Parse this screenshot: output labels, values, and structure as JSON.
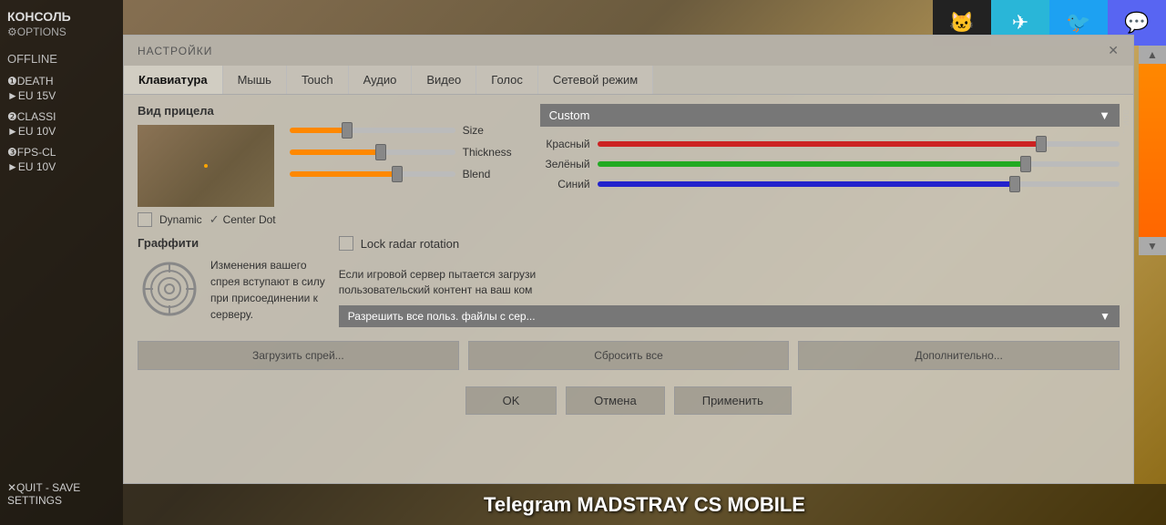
{
  "background": {
    "color": "#5a4a3a"
  },
  "sidebar": {
    "title": "КОНСОЛЬ",
    "options": "⚙OPTIONS",
    "offline": "OFFLINE",
    "items": [
      {
        "number": "❶",
        "name": "DEATH",
        "server": "►EU 15V"
      },
      {
        "number": "❷",
        "name": "CLASSI",
        "server": "►EU 10V"
      },
      {
        "number": "❸",
        "name": "FPS-CL",
        "server": "►EU 10V"
      }
    ],
    "quit_label": "✕QUIT - SAVE SETTINGS"
  },
  "top_icons": [
    {
      "name": "github",
      "symbol": "🐱",
      "bg": "#222"
    },
    {
      "name": "telegram",
      "symbol": "✈",
      "bg": "#29b6d8"
    },
    {
      "name": "twitter",
      "symbol": "🐦",
      "bg": "#1da1f2"
    },
    {
      "name": "discord",
      "symbol": "💬",
      "bg": "#5865f2"
    }
  ],
  "bottom_text": "Telegram MADSTRAY CS MOBILE",
  "modal": {
    "title": "НАСТРОЙКИ",
    "close": "✕",
    "tabs": [
      {
        "id": "keyboard",
        "label": "Клавиатура",
        "active": false
      },
      {
        "id": "mouse",
        "label": "Мышь",
        "active": false
      },
      {
        "id": "touch",
        "label": "Touch",
        "active": true
      },
      {
        "id": "audio",
        "label": "Аудио",
        "active": false
      },
      {
        "id": "video",
        "label": "Видео",
        "active": false
      },
      {
        "id": "voice",
        "label": "Голос",
        "active": false
      },
      {
        "id": "network",
        "label": "Сетевой режим",
        "active": false
      }
    ],
    "crosshair": {
      "section_label": "Вид прицела",
      "dynamic_label": "Dynamic",
      "center_dot_label": "Center Dot",
      "dynamic_checked": false,
      "center_dot_checked": true
    },
    "sliders": [
      {
        "id": "size",
        "label": "Size",
        "value": 35
      },
      {
        "id": "thickness",
        "label": "Thickness",
        "value": 55
      },
      {
        "id": "blend",
        "label": "Blend",
        "value": 65
      }
    ],
    "color": {
      "dropdown_label": "Custom",
      "dropdown_arrow": "▼",
      "sliders": [
        {
          "id": "red",
          "label": "Красный",
          "value": 85,
          "class": "red"
        },
        {
          "id": "green",
          "label": "Зелёный",
          "value": 82,
          "class": "green"
        },
        {
          "id": "blue",
          "label": "Синий",
          "value": 80,
          "class": "blue"
        }
      ]
    },
    "graffiti": {
      "section_label": "Граффити",
      "info_text": "Изменения вашего\nспрея вступают в силу\nпри присоединении к\nсерверу."
    },
    "lock_radar": {
      "label": "Lock radar rotation",
      "checked": false
    },
    "server": {
      "text": "Если игровой сервер пытается загрузи\nпользовательский контент на ваш ком",
      "dropdown_label": "Разрешить все польз. файлы с сер...",
      "dropdown_arrow": "▼"
    },
    "action_buttons": [
      {
        "id": "load_spray",
        "label": "Загрузить спрей..."
      },
      {
        "id": "reset_all",
        "label": "Сбросить все"
      },
      {
        "id": "additional",
        "label": "Дополнительно..."
      }
    ],
    "confirm_buttons": [
      {
        "id": "ok",
        "label": "OK"
      },
      {
        "id": "cancel",
        "label": "Отмена"
      },
      {
        "id": "apply",
        "label": "Применить"
      }
    ]
  }
}
